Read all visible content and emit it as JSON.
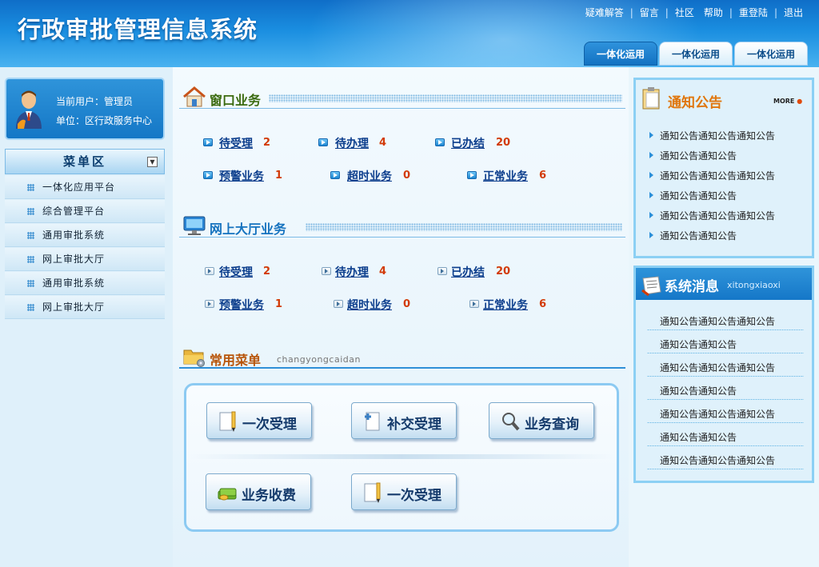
{
  "header": {
    "title": "行政审批管理信息系统",
    "links": [
      "疑难解答",
      "留言",
      "社区",
      "帮助",
      "重登陆",
      "退出"
    ],
    "tabs": [
      "一体化运用",
      "一体化运用",
      "一体化运用"
    ]
  },
  "user": {
    "current_user": "当前用户：管理员",
    "unit": "单位：区行政服务中心"
  },
  "menu": {
    "title": "菜单区",
    "items": [
      "一体化应用平台",
      "综合管理平台",
      "通用审批系统",
      "网上审批大厅",
      "通用审批系统",
      "网上审批大厅"
    ]
  },
  "window_business": {
    "title": "窗口业务",
    "items": [
      {
        "label": "待受理",
        "count": "2"
      },
      {
        "label": "待办理",
        "count": "4"
      },
      {
        "label": "已办结",
        "count": "20"
      },
      {
        "label": "预警业务",
        "count": "1"
      },
      {
        "label": "超时业务",
        "count": "0"
      },
      {
        "label": "正常业务",
        "count": "6"
      }
    ]
  },
  "online_hall": {
    "title": "网上大厅业务",
    "items": [
      {
        "label": "待受理",
        "count": "2"
      },
      {
        "label": "待办理",
        "count": "4"
      },
      {
        "label": "已办结",
        "count": "20"
      },
      {
        "label": "预警业务",
        "count": "1"
      },
      {
        "label": "超时业务",
        "count": "0"
      },
      {
        "label": "正常业务",
        "count": "6"
      }
    ]
  },
  "common_menu": {
    "title": "常用菜单",
    "subtitle": "changyongcaidan",
    "buttons": [
      "一次受理",
      "补交受理",
      "业务查询",
      "业务收费",
      "一次受理"
    ]
  },
  "notice": {
    "title": "通知公告",
    "more": "MORE",
    "items": [
      "通知公告通知公告通知公告",
      "通知公告通知公告",
      "通知公告通知公告通知公告",
      "通知公告通知公告",
      "通知公告通知公告通知公告",
      "通知公告通知公告"
    ]
  },
  "system_msg": {
    "title": "系统消息",
    "subtitle": "xitongxiaoxi",
    "items": [
      "通知公告通知公告通知公告",
      "通知公告通知公告",
      "通知公告通知公告通知公告",
      "通知公告通知公告",
      "通知公告通知公告通知公告",
      "通知公告通知公告",
      "通知公告通知公告通知公告"
    ]
  },
  "colors": {
    "brand": "#1677c9",
    "count": "#d23a07",
    "link": "#0b3d8c"
  }
}
